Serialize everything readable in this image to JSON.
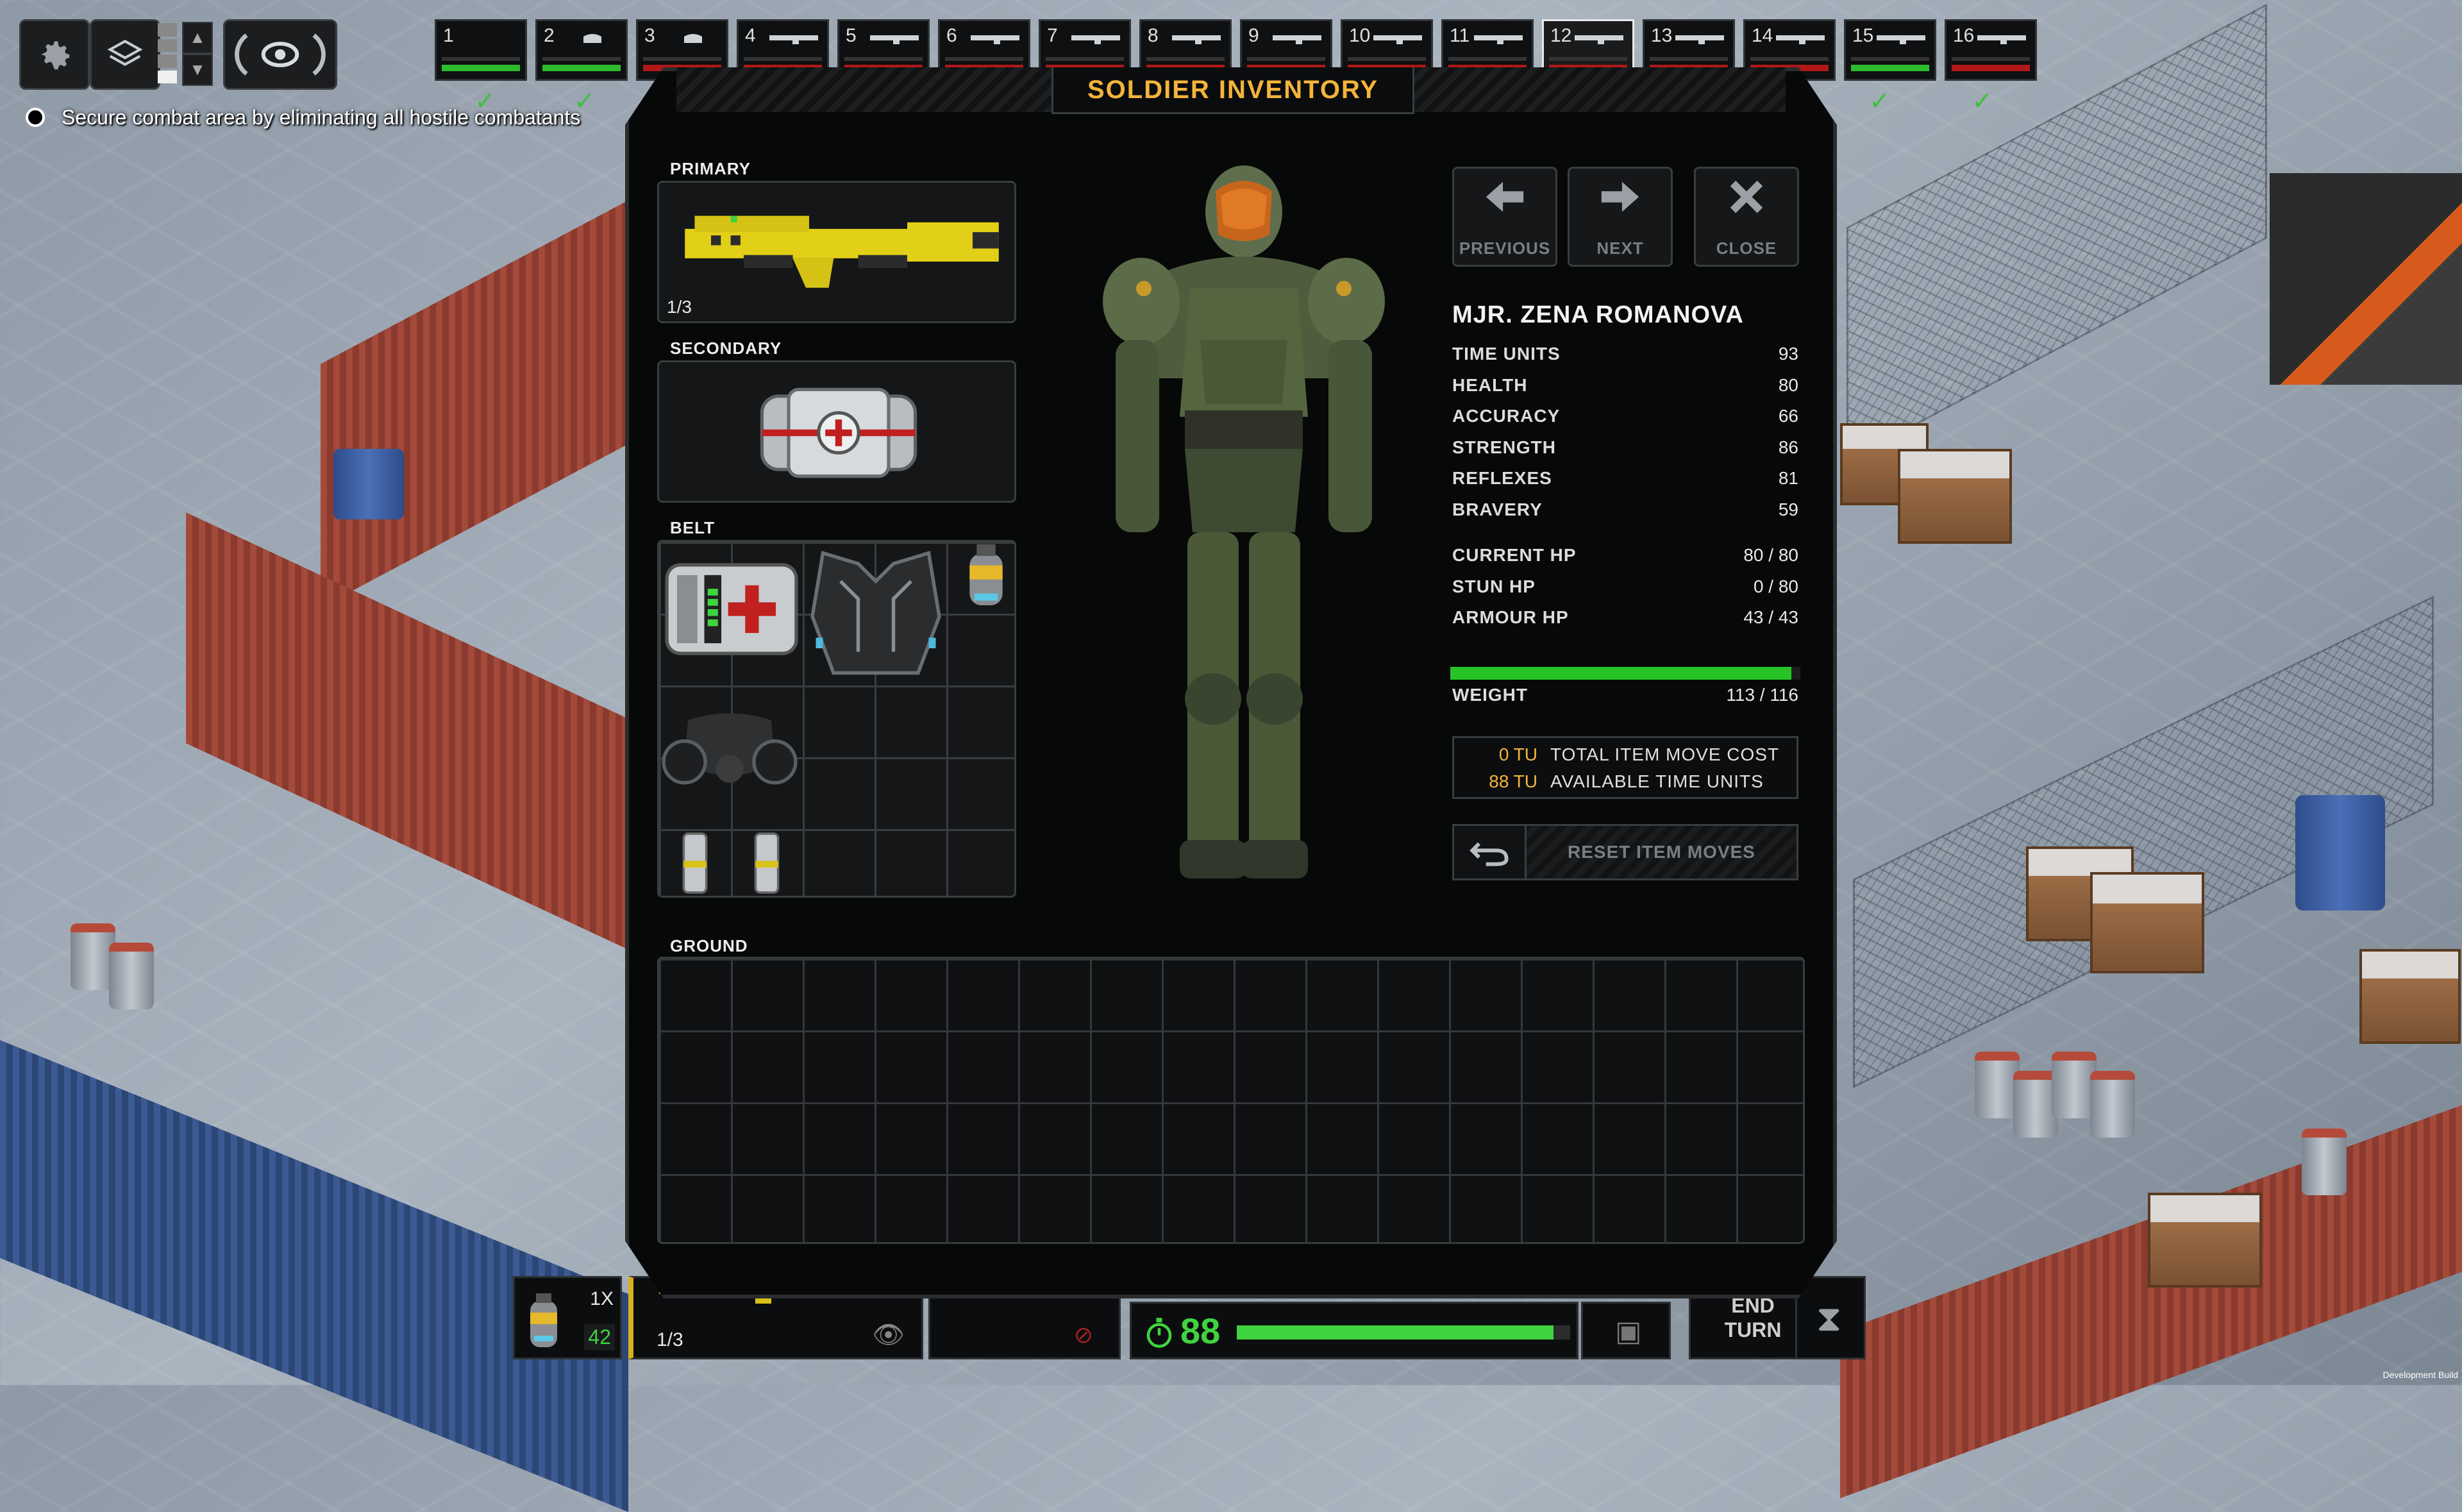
{
  "objective": "Secure combat area by eliminating all hostile combatants",
  "top_controls": {
    "settings_icon": "gear-icon",
    "layer_icon": "map-layers-icon",
    "camera_icon": "rotate-view-eye-icon"
  },
  "soldier_tabs": [
    {
      "num": "1",
      "weapon": "none"
    },
    {
      "num": "2",
      "weapon": "armor"
    },
    {
      "num": "3",
      "weapon": "armor"
    },
    {
      "num": "4",
      "weapon": "rifle"
    },
    {
      "num": "5",
      "weapon": "rifle"
    },
    {
      "num": "6",
      "weapon": "rifle"
    },
    {
      "num": "7",
      "weapon": "rifle"
    },
    {
      "num": "8",
      "weapon": "rifle"
    },
    {
      "num": "9",
      "weapon": "rifle"
    },
    {
      "num": "10",
      "weapon": "rifle"
    },
    {
      "num": "11",
      "weapon": "rifle"
    },
    {
      "num": "12",
      "weapon": "rifle"
    },
    {
      "num": "13",
      "weapon": "rifle"
    },
    {
      "num": "14",
      "weapon": "rifle"
    },
    {
      "num": "15",
      "weapon": "rifle"
    },
    {
      "num": "16",
      "weapon": "rifle"
    }
  ],
  "inventory": {
    "title": "SOLDIER INVENTORY",
    "primary_label": "PRIMARY",
    "primary_ammo": "1/3",
    "secondary_label": "SECONDARY",
    "belt_label": "BELT",
    "ground_label": "GROUND",
    "previous_label": "PREVIOUS",
    "next_label": "NEXT",
    "close_label": "CLOSE",
    "soldier_name": "MJR. ZENA ROMANOVA",
    "stats": [
      {
        "label": "TIME UNITS",
        "value": "93"
      },
      {
        "label": "HEALTH",
        "value": "80"
      },
      {
        "label": "ACCURACY",
        "value": "66"
      },
      {
        "label": "STRENGTH",
        "value": "86"
      },
      {
        "label": "REFLEXES",
        "value": "81"
      },
      {
        "label": "BRAVERY",
        "value": "59"
      }
    ],
    "hp_stats": [
      {
        "label": "CURRENT HP",
        "value": "80 / 80"
      },
      {
        "label": "STUN HP",
        "value": "0 / 80"
      },
      {
        "label": "ARMOUR HP",
        "value": "43 / 43"
      }
    ],
    "weight_label": "WEIGHT",
    "weight_value": "113 / 116",
    "weight_fraction": 0.974,
    "move_cost_value": "0 TU",
    "move_cost_label": "TOTAL ITEM MOVE COST",
    "available_value": "88 TU",
    "available_label": "AVAILABLE TIME UNITS",
    "reset_label": "RESET ITEM MOVES"
  },
  "hud": {
    "multiplier": "1X",
    "grenade_count": "42",
    "weapon_ammo": "1/3",
    "time_units": "88",
    "tu_fraction": 0.95,
    "end_turn_line1": "END",
    "end_turn_line2": "TURN",
    "dev_build": "Development Build"
  },
  "colors": {
    "accent": "#f4b43a",
    "health": "#b01818",
    "tu_green": "#27c427"
  }
}
